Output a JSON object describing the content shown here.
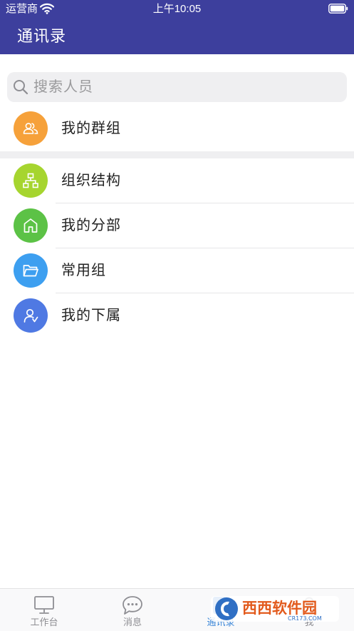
{
  "status_bar": {
    "carrier": "运营商",
    "time": "上午10:05"
  },
  "nav": {
    "title": "通讯录"
  },
  "search": {
    "placeholder": "搜索人员"
  },
  "sections": [
    {
      "items": [
        {
          "label": "我的群组",
          "icon": "group-icon",
          "color": "#f6a13a"
        }
      ]
    },
    {
      "items": [
        {
          "label": "组织结构",
          "icon": "org-chart-icon",
          "color": "#a6d52f"
        },
        {
          "label": "我的分部",
          "icon": "home-icon",
          "color": "#5cc246"
        },
        {
          "label": "常用组",
          "icon": "folder-icon",
          "color": "#3d9ff0"
        },
        {
          "label": "我的下属",
          "icon": "subordinate-user-icon",
          "color": "#4f79e3"
        }
      ]
    }
  ],
  "tabs": [
    {
      "label": "工作台",
      "icon": "desktop-icon",
      "active": false
    },
    {
      "label": "消息",
      "icon": "chat-bubble-icon",
      "active": false
    },
    {
      "label": "通讯录",
      "icon": "contacts-icon",
      "active": true
    },
    {
      "label": "我",
      "icon": "person-icon",
      "active": false
    }
  ],
  "watermark": {
    "brand": "西西软件园",
    "site": "CR173.COM"
  },
  "colors": {
    "header": "#3d3f9d",
    "active_tab": "#3a86d8",
    "inactive_tab": "#8e8e93"
  }
}
